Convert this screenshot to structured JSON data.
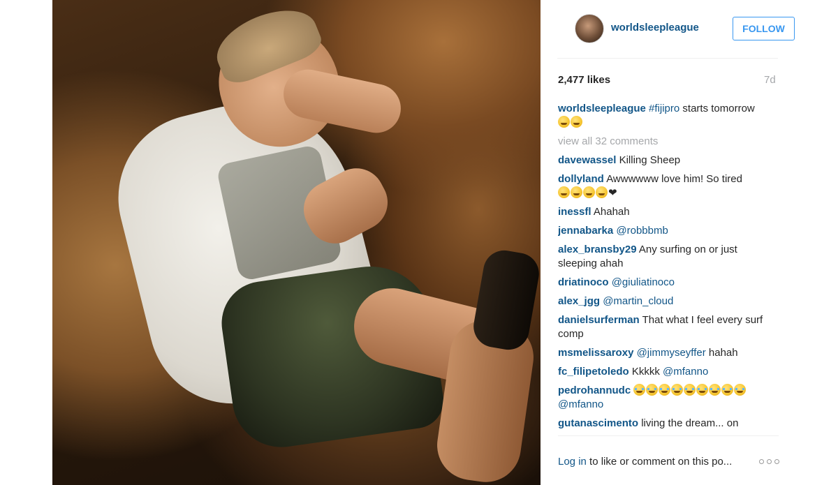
{
  "post": {
    "username": "worldsleepleague",
    "follow_label": "FOLLOW",
    "likes": "2,477 likes",
    "age": "7d",
    "caption": {
      "user": "worldsleepleague",
      "hashtag": "#fijipro",
      "text": " starts tomorrow",
      "emoji": [
        "sleeping-face",
        "sleeping-face"
      ]
    },
    "view_all": "view all 32 comments",
    "comments": [
      {
        "user": "davewassel",
        "text": "Killing Sheep"
      },
      {
        "user": "dollyland",
        "text": "Awwwwww love him! So tired",
        "emoji": [
          "sleeping-face",
          "sleeping-face",
          "sleeping-face",
          "sleeping-face"
        ],
        "suffix": "❤"
      },
      {
        "user": "inessfl",
        "text": "Ahahah"
      },
      {
        "user": "jennabarka",
        "mention": "@robbbmb"
      },
      {
        "user": "alex_bransby29",
        "text": "Any surfing on or just sleeping ahah"
      },
      {
        "user": "driatinoco",
        "mention": "@giuliatinoco"
      },
      {
        "user": "alex_jgg",
        "mention": "@martin_cloud"
      },
      {
        "user": "danielsurferman",
        "text": "That what I feel every surf comp"
      },
      {
        "user": "msmelissaroxy",
        "mention": "@jimmyseyffer",
        "text_after": " hahah"
      },
      {
        "user": "fc_filipetoledo",
        "text": "Kkkkk",
        "mention": "@mfanno"
      },
      {
        "user": "pedrohannudc",
        "emoji_joy": 9,
        "mention": "@mfanno"
      },
      {
        "user": "gutanascimento",
        "text": "living the dream... on"
      }
    ],
    "footer": {
      "login_link": "Log in",
      "login_text": " to like or comment on this po..."
    }
  },
  "colors": {
    "link": "#125688",
    "follow": "#3897f0",
    "muted": "#a5a7aa"
  }
}
